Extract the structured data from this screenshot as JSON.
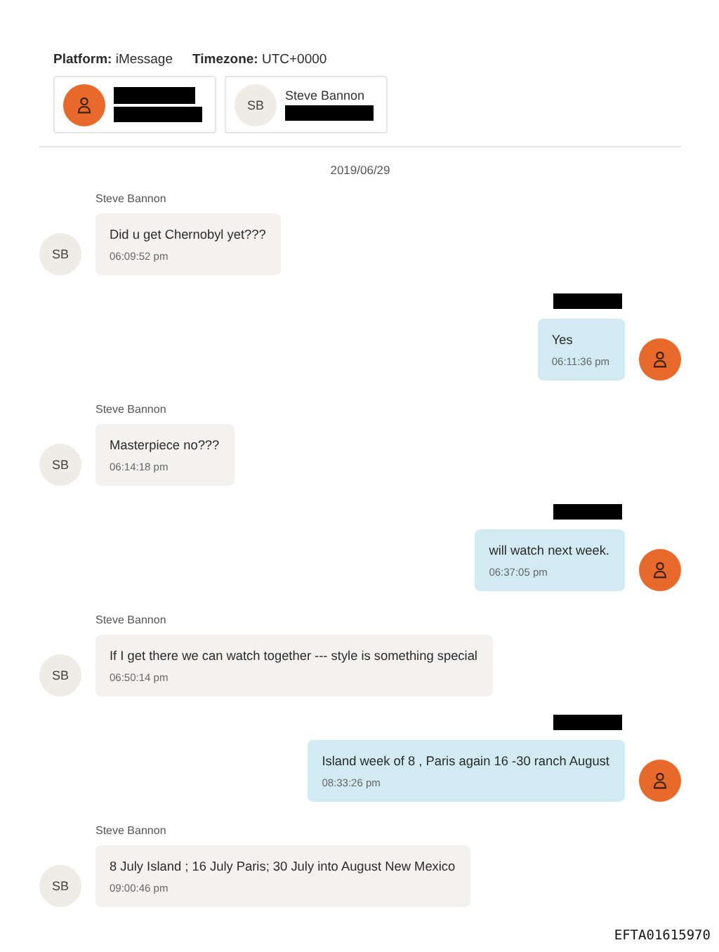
{
  "header": {
    "platform": "**Platform:** iMessage",
    "timezone": "**Timezone:** UTC+0000"
  },
  "participants": [
    {
      "kind": "icon",
      "name_redacted": true,
      "detail_redacted": true
    },
    {
      "kind": "initials",
      "initials": "SB",
      "name": "Steve Bannon",
      "detail_redacted": true
    }
  ],
  "date": "2019/06/29",
  "messages": [
    {
      "kind": "incoming",
      "sender": "Steve Bannon",
      "initials": "SB",
      "text": "Did u get Chernobyl yet???",
      "time": "06:09:52 pm"
    },
    {
      "kind": "outgoing",
      "sender_redacted": true,
      "text": "Yes",
      "time": "06:11:36 pm"
    },
    {
      "kind": "incoming",
      "sender": "Steve Bannon",
      "initials": "SB",
      "text": "Masterpiece no???",
      "time": "06:14:18 pm"
    },
    {
      "kind": "outgoing",
      "sender_redacted": true,
      "text": "will watch next week.",
      "time": "06:37:05 pm"
    },
    {
      "kind": "incoming",
      "sender": "Steve Bannon",
      "initials": "SB",
      "text": "If I get there we can watch together --- style is something special",
      "time": "06:50:14 pm"
    },
    {
      "kind": "outgoing",
      "sender_redacted": true,
      "text": "Island week of 8 , Paris again 16 -30 ranch August",
      "time": "08:33:26 pm"
    },
    {
      "kind": "incoming",
      "sender": "Steve Bannon",
      "initials": "SB",
      "text": "8 July Island ; 16 July Paris; 30 July into August New Mexico",
      "time": "09:00:46 pm"
    }
  ],
  "document_id": "EFTA01615970"
}
